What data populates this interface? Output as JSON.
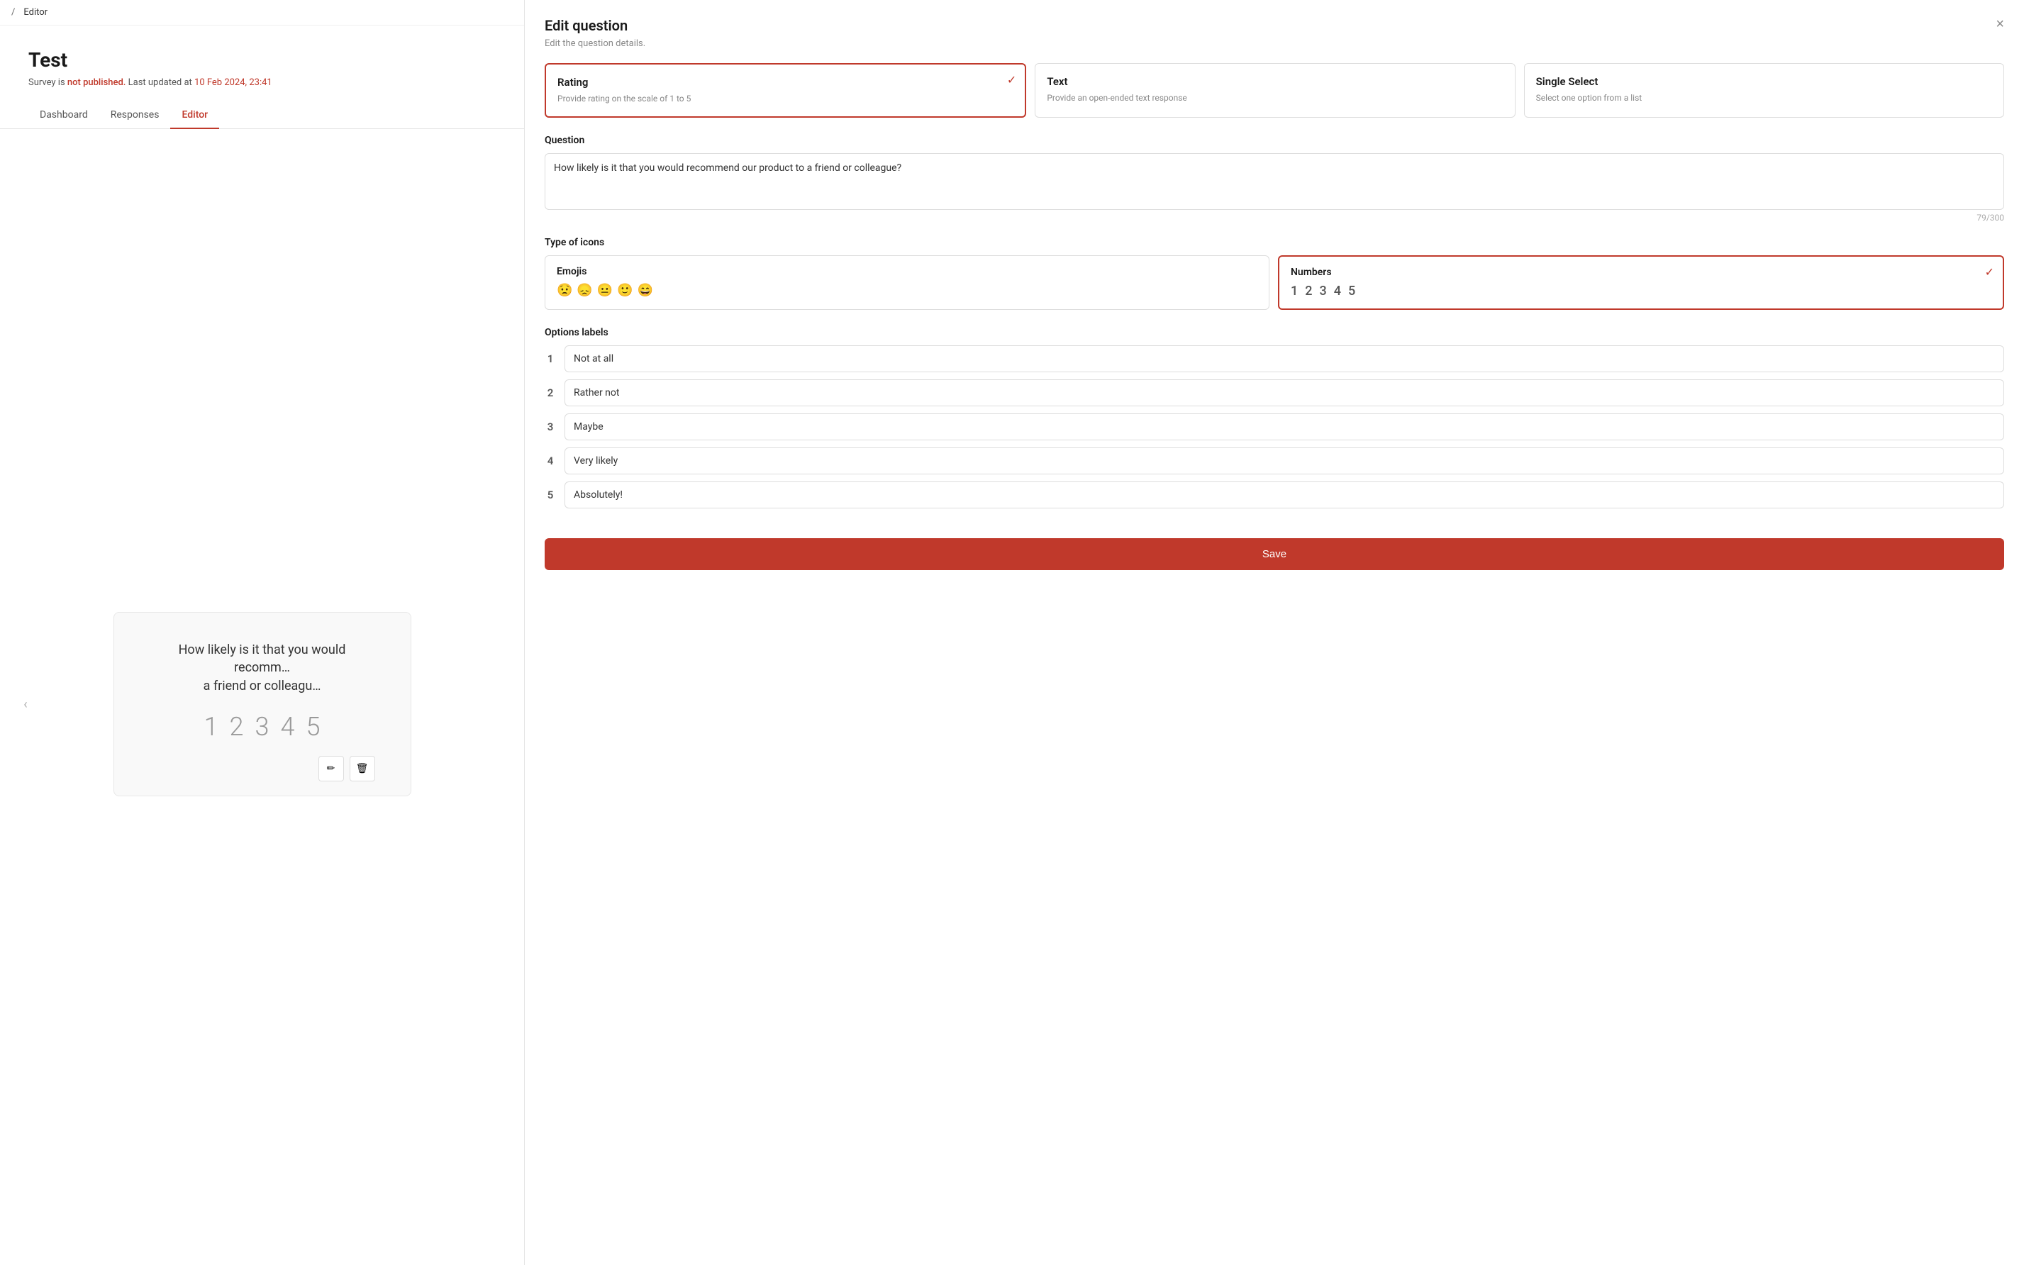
{
  "breadcrumb": {
    "separator": "/",
    "current": "Editor"
  },
  "survey": {
    "title": "Test",
    "meta_prefix": "Survey is",
    "status": "not published.",
    "meta_suffix": "Last updated at",
    "date": "10 Feb 2024, 23:41"
  },
  "nav": {
    "tabs": [
      "Dashboard",
      "Responses",
      "Editor"
    ],
    "active": "Editor"
  },
  "preview": {
    "question_text": "How likely is it that you would recomm… a friend or colleagu…",
    "numbers": "1 2 3 4 5"
  },
  "edit_panel": {
    "title": "Edit question",
    "subtitle": "Edit the question details.",
    "close_label": "×",
    "type_cards": [
      {
        "id": "rating",
        "title": "Rating",
        "description": "Provide rating on the scale of 1 to 5",
        "selected": true
      },
      {
        "id": "text",
        "title": "Text",
        "description": "Provide an open-ended text response",
        "selected": false
      },
      {
        "id": "single_select",
        "title": "Single Select",
        "description": "Select one option from a list",
        "selected": false
      }
    ],
    "question_label": "Question",
    "question_value": "How likely is it that you would recommend our product to a friend or colleague?",
    "char_count": "79/300",
    "icons_label": "Type of icons",
    "icon_types": [
      {
        "id": "emojis",
        "title": "Emojis",
        "icons": [
          "😟",
          "😞",
          "😐",
          "🙂",
          "😄"
        ],
        "selected": false
      },
      {
        "id": "numbers",
        "title": "Numbers",
        "icons": [
          "1",
          "2",
          "3",
          "4",
          "5"
        ],
        "selected": true
      }
    ],
    "options_label": "Options labels",
    "options": [
      {
        "number": "1",
        "value": "Not at all"
      },
      {
        "number": "2",
        "value": "Rather not"
      },
      {
        "number": "3",
        "value": "Maybe"
      },
      {
        "number": "4",
        "value": "Very likely"
      },
      {
        "number": "5",
        "value": "Absolutely!"
      }
    ],
    "save_label": "Save"
  }
}
